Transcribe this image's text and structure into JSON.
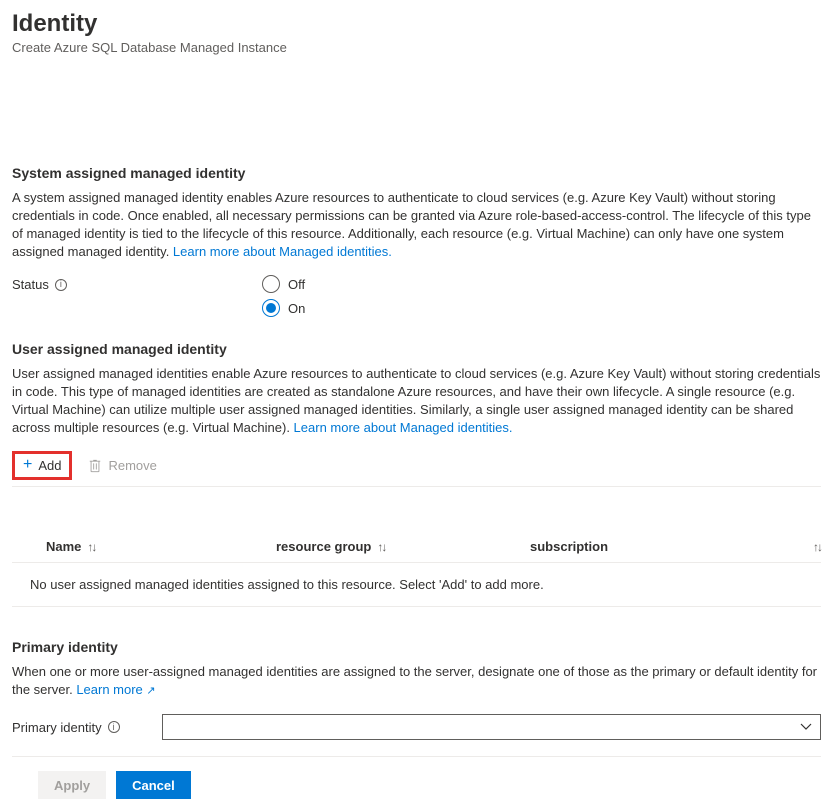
{
  "header": {
    "title": "Identity",
    "subtitle": "Create Azure SQL Database Managed Instance"
  },
  "systemAssigned": {
    "heading": "System assigned managed identity",
    "description": "A system assigned managed identity enables Azure resources to authenticate to cloud services (e.g. Azure Key Vault) without storing credentials in code. Once enabled, all necessary permissions can be granted via Azure role-based-access-control. The lifecycle of this type of managed identity is tied to the lifecycle of this resource. Additionally, each resource (e.g. Virtual Machine) can only have one system assigned managed identity. ",
    "learnMore": "Learn more about Managed identities.",
    "statusLabel": "Status",
    "options": {
      "off": "Off",
      "on": "On"
    },
    "selected": "on"
  },
  "userAssigned": {
    "heading": "User assigned managed identity",
    "description": "User assigned managed identities enable Azure resources to authenticate to cloud services (e.g. Azure Key Vault) without storing credentials in code. This type of managed identities are created as standalone Azure resources, and have their own lifecycle. A single resource (e.g. Virtual Machine) can utilize multiple user assigned managed identities. Similarly, a single user assigned managed identity can be shared across multiple resources (e.g. Virtual Machine). ",
    "learnMore": "Learn more about Managed identities.",
    "addLabel": "Add",
    "removeLabel": "Remove",
    "columns": {
      "name": "Name",
      "rg": "resource group",
      "sub": "subscription"
    },
    "emptyMessage": "No user assigned managed identities assigned to this resource. Select 'Add' to add more."
  },
  "primary": {
    "heading": "Primary identity",
    "description": "When one or more user-assigned managed identities are assigned to the server, designate one of those as the primary or default identity for the server. ",
    "learnMore": "Learn more",
    "label": "Primary identity"
  },
  "footer": {
    "apply": "Apply",
    "cancel": "Cancel"
  }
}
